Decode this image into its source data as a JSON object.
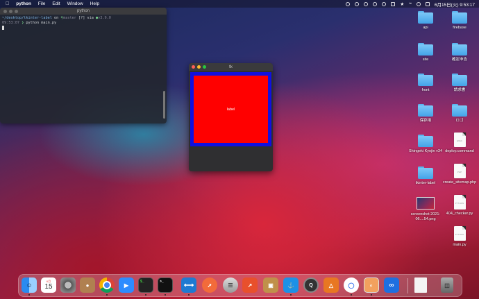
{
  "menubar": {
    "app_name": "python",
    "menus": [
      "File",
      "Edit",
      "Window",
      "Help"
    ],
    "datetime": "6月15日(火)  9:53:17"
  },
  "terminal": {
    "title": "python",
    "line1_path": "~/desktop/tkinter-label",
    "line1_on": "on",
    "line1_branch": "master",
    "line1_status": "[?]",
    "line1_via": "via",
    "line1_version": "v3.9.0",
    "line2_time": "09:53:07",
    "line2_cmd": "python main.py"
  },
  "tk_window": {
    "title": "tk",
    "label_text": "label",
    "frame_color": "#1010e0",
    "label_bg": "#ff0000"
  },
  "desktop_icons": [
    {
      "name": "api",
      "type": "folder"
    },
    {
      "name": "firebase",
      "type": "folder"
    },
    {
      "name": "site",
      "type": "folder"
    },
    {
      "name": "確定申告",
      "type": "folder"
    },
    {
      "name": "front",
      "type": "folder"
    },
    {
      "name": "請求書",
      "type": "folder"
    },
    {
      "name": "保存用",
      "type": "folder"
    },
    {
      "name": "ロゴ",
      "type": "folder"
    },
    {
      "name": "Shingeki Kyojin v34",
      "type": "folder"
    },
    {
      "name": "deploy.command",
      "type": "doc",
      "tag": "EXEC"
    },
    {
      "name": "tkinter-label",
      "type": "folder"
    },
    {
      "name": "create_sitemap.php",
      "type": "doc",
      "tag": "PHP"
    },
    {
      "name": "screenshot 2021-06....54.png",
      "type": "image"
    },
    {
      "name": "404_checker.py",
      "type": "doc",
      "tag": "PYTHON"
    },
    {
      "name": "main.py",
      "type": "doc",
      "tag": "PYTHON"
    }
  ],
  "dock": {
    "calendar_month": "6月",
    "calendar_day": "15",
    "apps": [
      "Finder",
      "Calendar",
      "System Preferences",
      "Contacts",
      "Chrome",
      "Zoom",
      "Terminal",
      "Terminal",
      "VS Code",
      "Postman",
      "Sequel Pro",
      "Tableplus",
      "Archive",
      "Docker",
      "QuickTime",
      "Sourcetree",
      "Signal",
      "Preview",
      "Infinity"
    ]
  }
}
